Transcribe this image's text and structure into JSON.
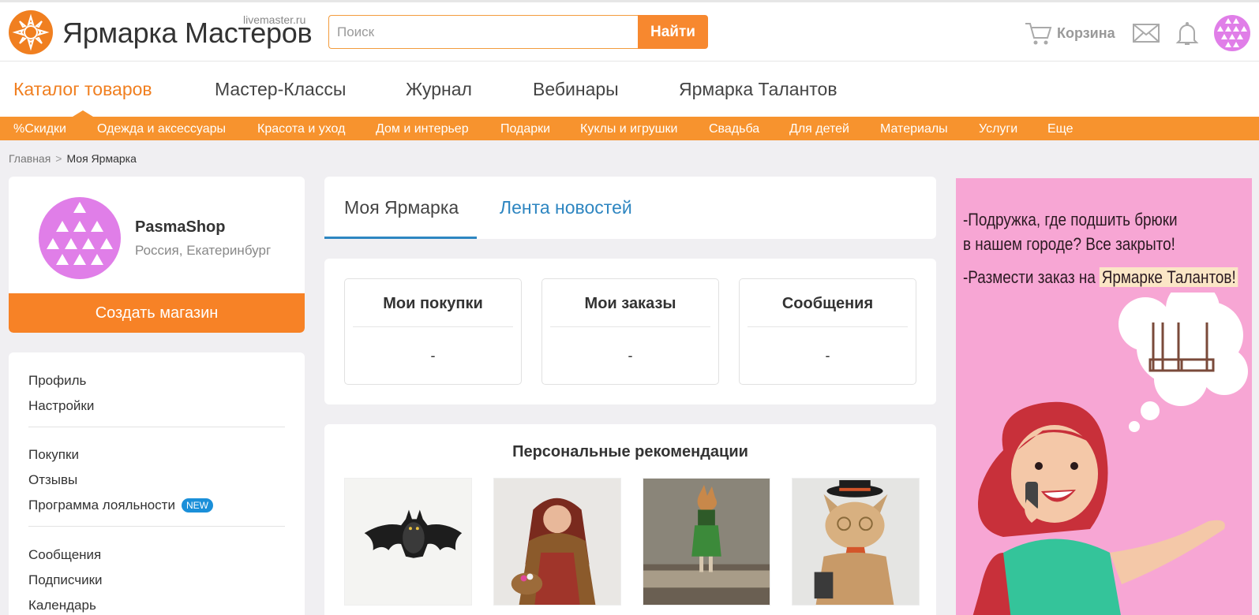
{
  "header": {
    "domain": "livemaster.ru",
    "logo_text": "Ярмарка Мастеров",
    "search_placeholder": "Поиск",
    "search_button": "Найти",
    "cart_label": "Корзина",
    "icons": [
      "cart-icon",
      "mail-icon",
      "bell-icon",
      "avatar"
    ]
  },
  "main_nav": [
    {
      "label": "Каталог товаров",
      "active": true
    },
    {
      "label": "Мастер-Классы",
      "active": false
    },
    {
      "label": "Журнал",
      "active": false
    },
    {
      "label": "Вебинары",
      "active": false
    },
    {
      "label": "Ярмарка Талантов",
      "active": false
    }
  ],
  "categories": [
    "%Скидки",
    "Одежда и аксессуары",
    "Красота и уход",
    "Дом и интерьер",
    "Подарки",
    "Куклы и игрушки",
    "Свадьба",
    "Для детей",
    "Материалы",
    "Услуги",
    "Еще"
  ],
  "breadcrumb": {
    "home": "Главная",
    "separator": ">",
    "current": "Моя Ярмарка"
  },
  "profile": {
    "name": "PasmaShop",
    "location": "Россия, Екатеринбург",
    "create_shop": "Создать магазин"
  },
  "menu": {
    "group1": [
      "Профиль",
      "Настройки"
    ],
    "group2": [
      "Покупки",
      "Отзывы",
      "Программа лояльности"
    ],
    "badge_new": "NEW",
    "group3": [
      "Сообщения",
      "Подписчики",
      "Календарь"
    ]
  },
  "tabs": {
    "active": "Моя Ярмарка",
    "other": "Лента новостей"
  },
  "stats": [
    {
      "title": "Мои покупки",
      "value": "-"
    },
    {
      "title": "Мои заказы",
      "value": "-"
    },
    {
      "title": "Сообщения",
      "value": "-"
    }
  ],
  "recommendations": {
    "title": "Персональные рекомендации"
  },
  "banner": {
    "line1": "-Подружка, где подшить брюки",
    "line2": "в нашем городе? Все закрыто!",
    "line3_prefix": "-Размести заказ на ",
    "line3_highlight": "Ярмарке Талантов!"
  },
  "colors": {
    "accent": "#f7882f",
    "link": "#2e86c1",
    "banner_bg": "#f7a6d4",
    "avatar": "#e07ee8"
  }
}
